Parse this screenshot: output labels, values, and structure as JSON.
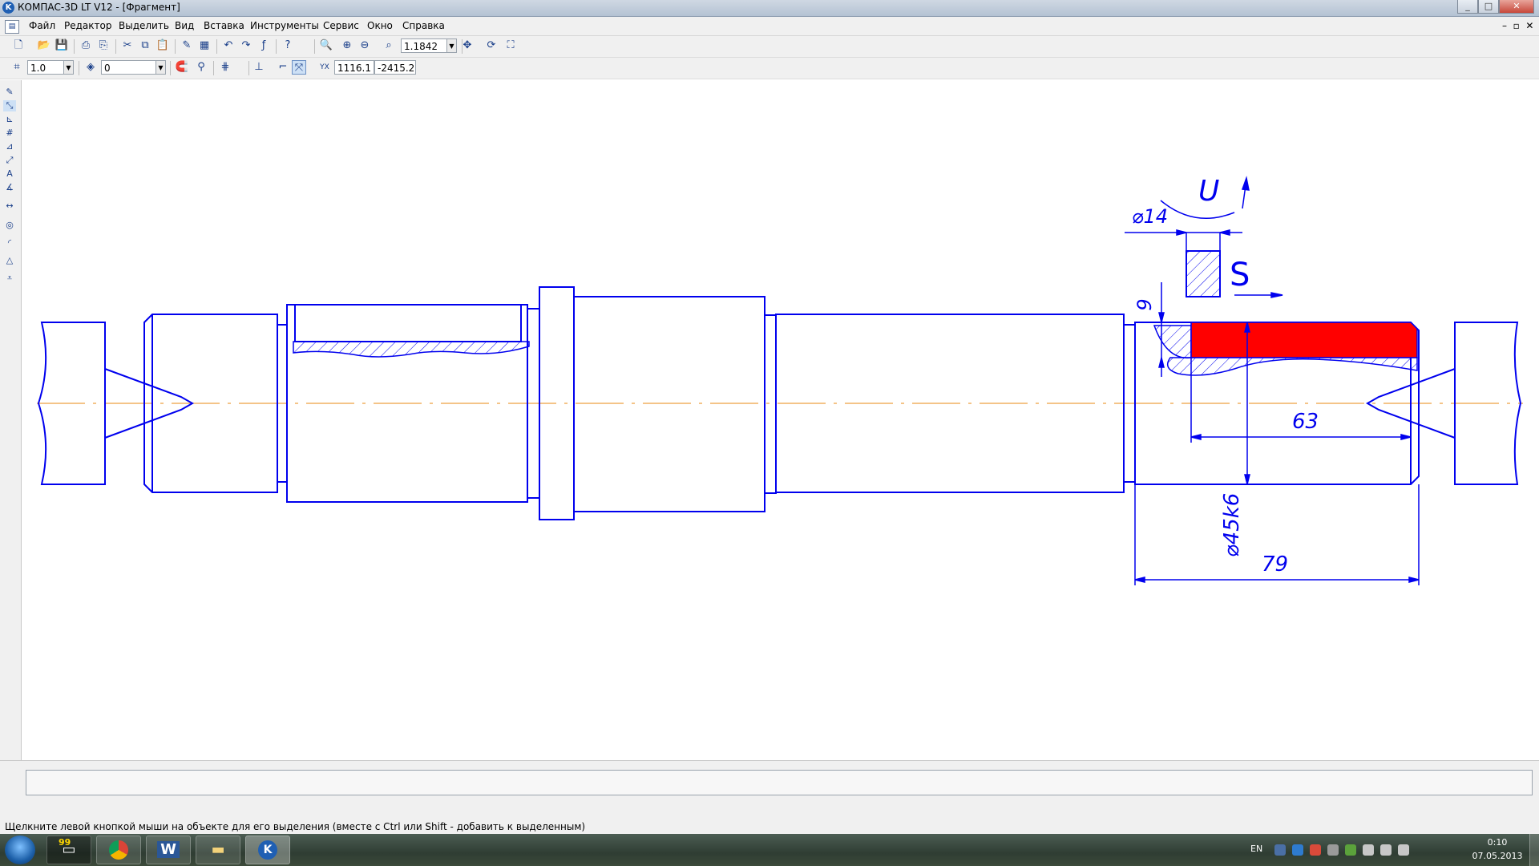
{
  "window": {
    "title": "КОМПАС-3D LT V12 - [Фрагмент]",
    "buttons": [
      "_",
      "□",
      "✕"
    ]
  },
  "menu": [
    "Файл",
    "Редактор",
    "Выделить",
    "Вид",
    "Вставка",
    "Инструменты",
    "Сервис",
    "Окно",
    "Справка"
  ],
  "toolbar1": {
    "zoom_value": "1.1842"
  },
  "toolbar2": {
    "step_value": "1.0",
    "layer_value": "0",
    "coord_x": "1116.1",
    "coord_y": "-2415.2"
  },
  "drawing": {
    "dim_diameter_14": "⌀14",
    "label_U": "U",
    "label_S": "S",
    "dim_9": "9",
    "dim_63": "63",
    "dim_diameter_45k6": "⌀45k6",
    "dim_79": "79",
    "colors": {
      "contour": "#0000ee",
      "axis": "#f0b060",
      "highlight": "#ff0000"
    }
  },
  "status_text": "Щелкните левой кнопкой мыши на объекте для его выделения (вместе с Ctrl или Shift - добавить к выделенным)",
  "taskbar": {
    "items": [
      "windows-start",
      "cmd-99",
      "chrome",
      "word",
      "explorer",
      "kompas"
    ],
    "badge": "99",
    "language": "EN",
    "time": "0:10",
    "date": "07.05.2013"
  }
}
